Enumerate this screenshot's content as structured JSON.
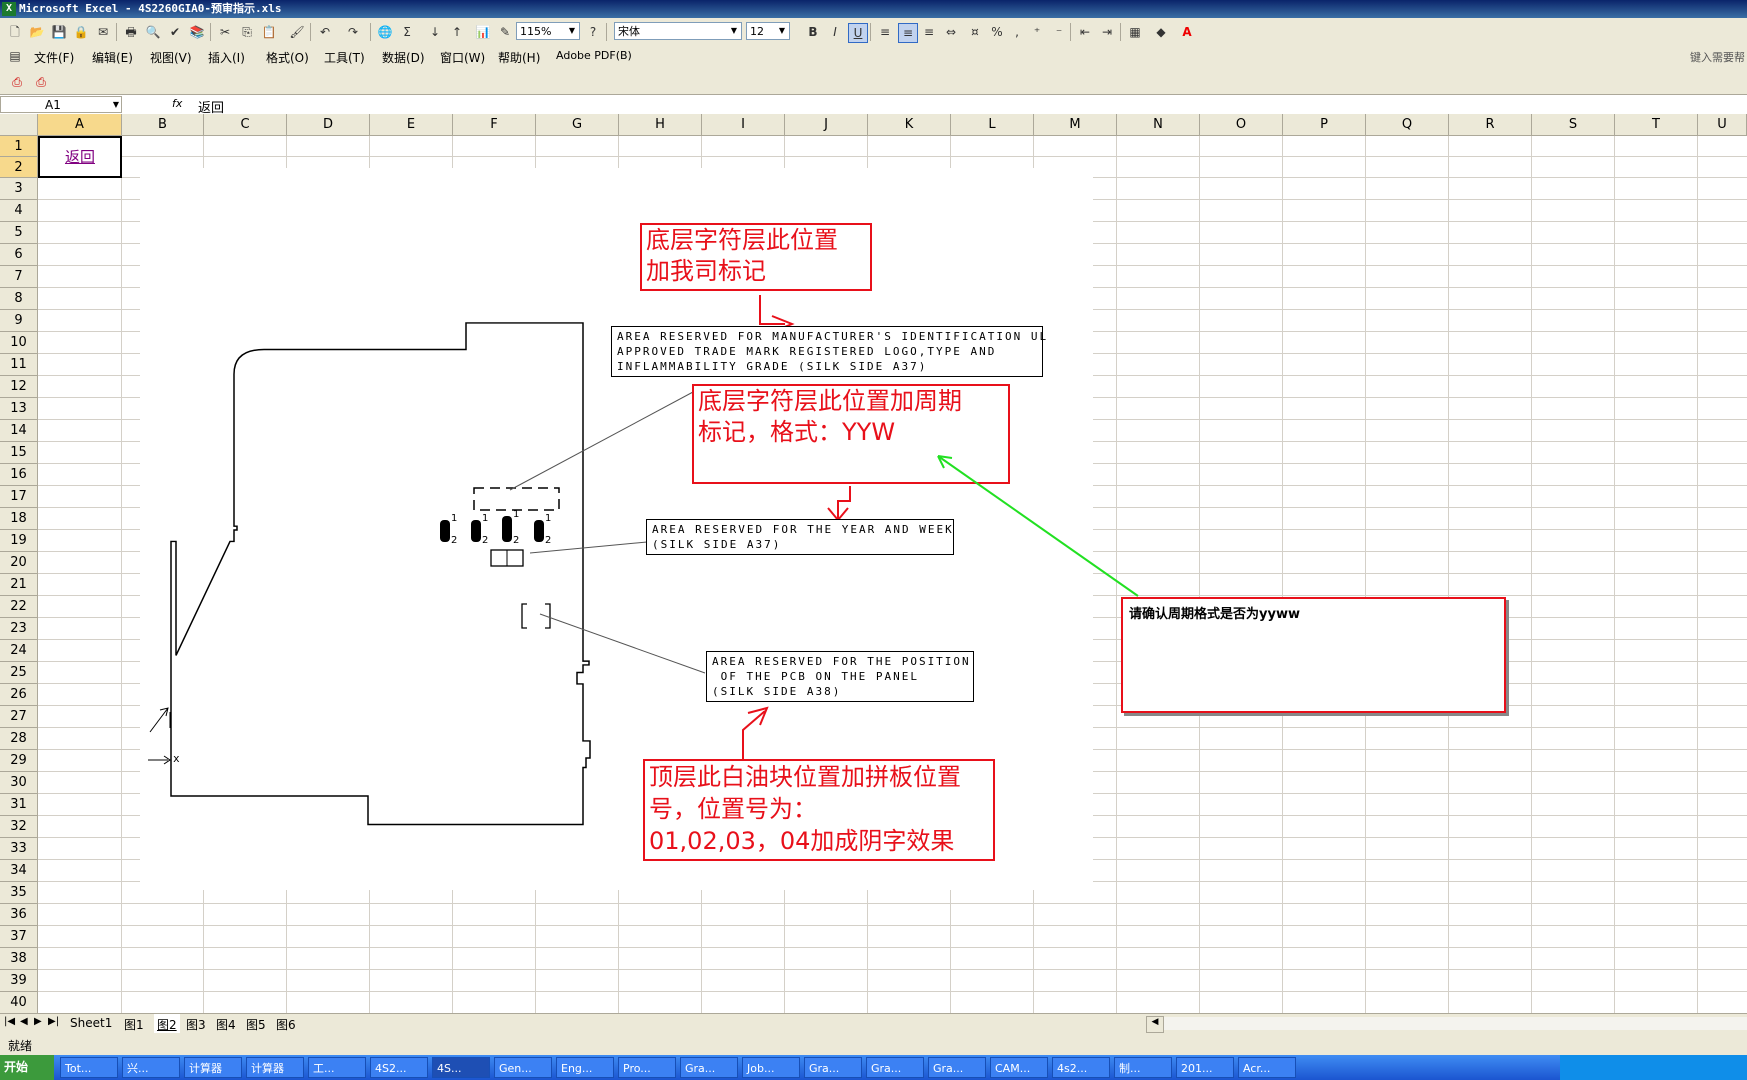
{
  "window": {
    "title": "Microsoft Excel - 4S2260GIA0-预审指示.xls",
    "right_hint": "键入需要帮"
  },
  "toolbar": {
    "zoom": "115%",
    "font": "宋体",
    "font_size": "12",
    "bold": "B",
    "italic": "I",
    "underline": "U",
    "percent": "%",
    "comma": ","
  },
  "menu": {
    "items": [
      "文件(F)",
      "编辑(E)",
      "视图(V)",
      "插入(I)",
      "格式(O)",
      "工具(T)",
      "数据(D)",
      "窗口(W)",
      "帮助(H)",
      "Adobe PDF(B)"
    ]
  },
  "formula": {
    "cell_ref": "A1",
    "fx": "fx",
    "value": "返回"
  },
  "columns": [
    "A",
    "B",
    "C",
    "D",
    "E",
    "F",
    "G",
    "H",
    "I",
    "J",
    "K",
    "L",
    "M",
    "N",
    "O",
    "P",
    "Q",
    "R",
    "S",
    "T",
    "U"
  ],
  "rows": [
    "1",
    "2",
    "3",
    "4",
    "5",
    "6",
    "7",
    "8",
    "9",
    "10",
    "11",
    "12",
    "13",
    "14",
    "15",
    "16",
    "17",
    "18",
    "19",
    "20",
    "21",
    "22",
    "23",
    "24",
    "25",
    "26",
    "27",
    "28",
    "29",
    "30",
    "31",
    "32",
    "33",
    "34",
    "35",
    "36",
    "37",
    "38",
    "39",
    "40"
  ],
  "cell_a1": "返回",
  "notes": {
    "n1": "底层字符层此位置\n加我司标记",
    "n2": "底层字符层此位置加周期\n标记，格式：YYW",
    "n3": "顶层此白油块位置加拼板位置\n号，位置号为：\n01,02,03，04加成阴字效果",
    "comment": "请确认周期格式是否为yyww"
  },
  "labels": {
    "l1": "AREA RESERVED FOR MANUFACTURER'S IDENTIFICATION UL\nAPPROVED TRADE MARK REGISTERED LOGO,TYPE AND\nINFLAMMABILITY GRADE (SILK SIDE A37)",
    "l2": "AREA RESERVED FOR THE YEAR AND WEEK\n(SILK SIDE A37)",
    "l3": "AREA RESERVED FOR THE POSITION\n OF THE PCB ON THE PANEL\n(SILK SIDE A38)"
  },
  "pins": {
    "p1": "1",
    "p2": "2"
  },
  "axis": {
    "x": "x"
  },
  "tabs": [
    "Sheet1",
    "图1",
    "图2",
    "图3",
    "图4",
    "图5",
    "图6"
  ],
  "active_tab": "图2",
  "status": "就绪",
  "taskbar": {
    "start": "开始",
    "items": [
      "Tot...",
      "兴...",
      "计算器",
      "计算器",
      "工...",
      "4S2...",
      "4S...",
      "Gen...",
      "Eng...",
      "Pro...",
      "Gra...",
      "Job...",
      "Gra...",
      "Gra...",
      "Gra...",
      "CAM...",
      "4s2...",
      "制...",
      "201...",
      "Acr..."
    ]
  }
}
